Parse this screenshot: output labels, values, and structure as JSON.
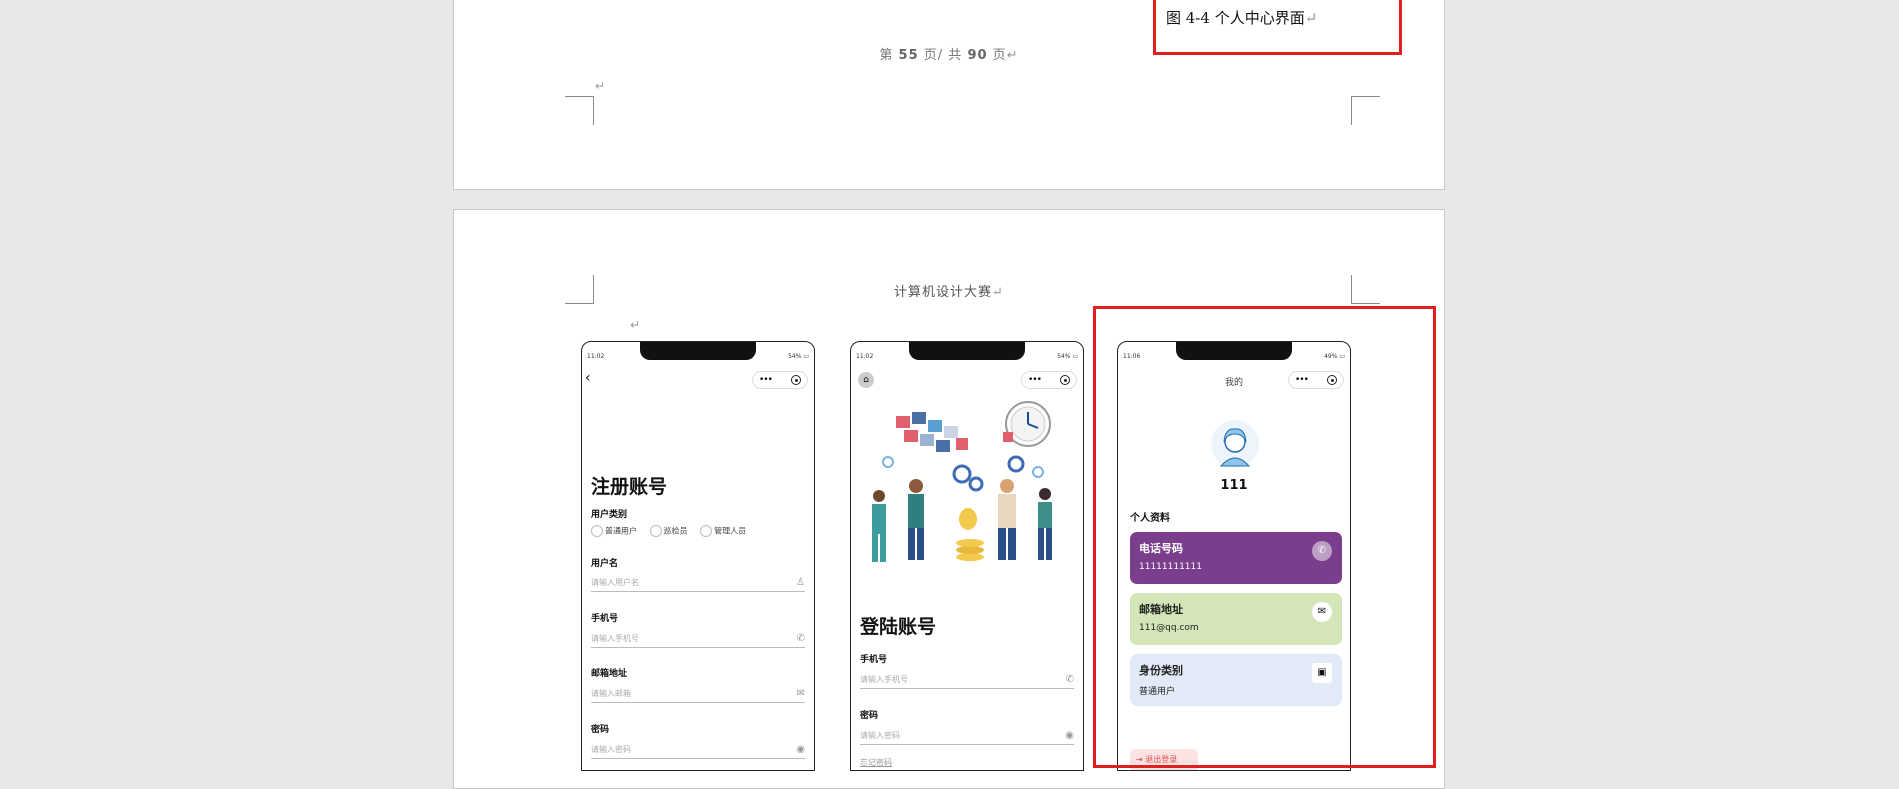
{
  "page1": {
    "figure_caption": "图 4-4 个人中心界面",
    "page_number": {
      "prefix": "第",
      "current": "55",
      "mid": "页/ 共",
      "total": "90",
      "suffix": "页"
    },
    "return_mark": "↵"
  },
  "page2": {
    "header_title": "计算机设计大赛",
    "return_mark": "↵"
  },
  "register": {
    "time": "11:02",
    "battery": "54%",
    "back_icon": "chevron-left-icon",
    "title": "注册账号",
    "user_type_label": "用户类别",
    "user_types": [
      "普通用户",
      "巡检员",
      "管理人员"
    ],
    "username_label": "用户名",
    "username_placeholder": "请输入用户名",
    "phone_label": "手机号",
    "phone_placeholder": "请输入手机号",
    "email_label": "邮箱地址",
    "email_placeholder": "请输入邮箱",
    "password_label": "密码",
    "password_placeholder": "请输入密码"
  },
  "login": {
    "time": "11:02",
    "battery": "54%",
    "home_icon": "home-icon",
    "title": "登陆账号",
    "phone_label": "手机号",
    "phone_placeholder": "请输入手机号",
    "password_label": "密码",
    "password_placeholder": "请输入密码",
    "forgot_link": "忘记密码"
  },
  "profile": {
    "time": "11:06",
    "battery": "49%",
    "nav_title": "我的",
    "username": "111",
    "section_title": "个人资料",
    "cards": [
      {
        "title": "电话号码",
        "value": "11111111111",
        "icon": "phone-icon",
        "bg": "#7a3e8c",
        "fg": "#ffffff"
      },
      {
        "title": "邮箱地址",
        "value": "111@qq.com",
        "icon": "mail-icon",
        "bg": "#d4e6b8",
        "fg": "#222222"
      },
      {
        "title": "身份类别",
        "value": "普通用户",
        "icon": "id-card-icon",
        "bg": "#e2eaf8",
        "fg": "#222222"
      }
    ],
    "logout_label": "退出登录"
  },
  "colors": {
    "highlight": "#e02020",
    "page_bg": "#e8e8e8"
  }
}
